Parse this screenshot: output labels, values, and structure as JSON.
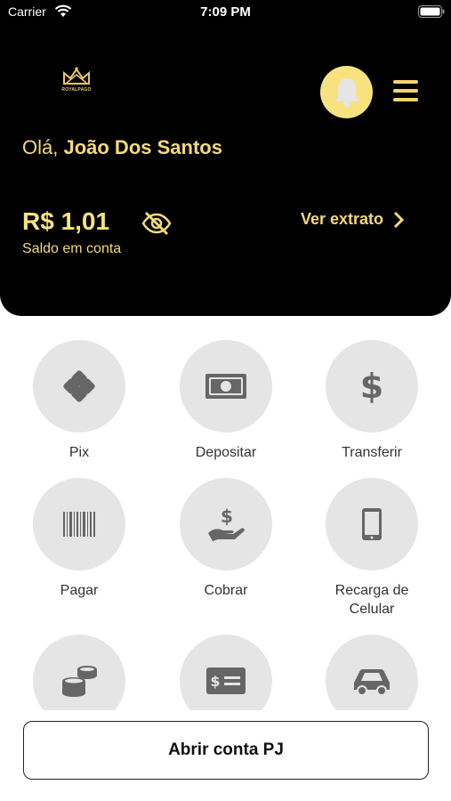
{
  "status_bar": {
    "carrier": "Carrier",
    "time": "7:09 PM"
  },
  "brand": {
    "logo_text": "ROYALPAGO"
  },
  "greeting": {
    "prefix": "Olá, ",
    "name": "João Dos Santos"
  },
  "balance": {
    "amount": "R$ 1,01",
    "label": "Saldo em conta"
  },
  "extract_link": {
    "label": "Ver extrato"
  },
  "actions": [
    {
      "label": "Pix",
      "icon": "pix-icon"
    },
    {
      "label": "Depositar",
      "icon": "banknote-icon"
    },
    {
      "label": "Transferir",
      "icon": "dollar-icon"
    },
    {
      "label": "Pagar",
      "icon": "barcode-icon"
    },
    {
      "label": "Cobrar",
      "icon": "hand-money-icon"
    },
    {
      "label": "Recarga de Celular",
      "icon": "phone-icon"
    },
    {
      "label": "",
      "icon": "coins-icon"
    },
    {
      "label": "",
      "icon": "check-card-icon"
    },
    {
      "label": "",
      "icon": "car-icon"
    }
  ],
  "footer": {
    "open_pj_label": "Abrir conta PJ"
  },
  "colors": {
    "header_bg": "#000000",
    "accent": "#f7e27f",
    "action_bg": "#e5e5e5",
    "icon_gray": "#666666"
  }
}
